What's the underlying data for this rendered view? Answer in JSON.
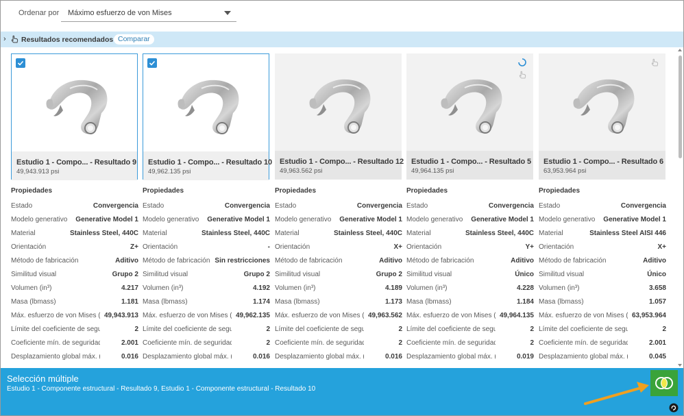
{
  "sort": {
    "label": "Ordenar por",
    "value": "Máximo esfuerzo de von Mises"
  },
  "recommended": {
    "title": "Resultados recomendados",
    "compare_label": "Comparar"
  },
  "cards": [
    {
      "title": "Estudio 1 - Compo... - Resultado 9",
      "value": "49,943.913 psi",
      "selected": true,
      "icon": "none"
    },
    {
      "title": "Estudio 1 - Compo... - Resultado 10",
      "value": "49,962.135 psi",
      "selected": true,
      "icon": "none"
    },
    {
      "title": "Estudio 1 - Compo... - Resultado 12",
      "value": "49,963.562 psi",
      "selected": false,
      "icon": "none"
    },
    {
      "title": "Estudio 1 - Compo... - Resultado 5",
      "value": "49,964.135 psi",
      "selected": false,
      "icon": "spinner-and-hand-icon"
    },
    {
      "title": "Estudio 1 - Compo... - Resultado 6",
      "value": "63,953.964 psi",
      "selected": false,
      "icon": "hand-icon"
    }
  ],
  "properties": {
    "heading": "Propiedades",
    "labels": [
      "Estado",
      "Modelo generativo",
      "Material",
      "Orientación",
      "Método de fabricación",
      "Similitud visual",
      "Volumen (in³)",
      "Masa (lbmass)",
      "Máx. esfuerzo de von Mises (...",
      "Límite del coeficiente de seguridad",
      "Coeficiente mín. de seguridad",
      "Desplazamiento global máx. (in)"
    ],
    "columns": [
      [
        "Convergencia",
        "Generative Model 1",
        "Stainless Steel, 440C",
        "Z+",
        "Aditivo",
        "Grupo 2",
        "4.217",
        "1.181",
        "49,943.913",
        "2",
        "2.001",
        "0.016"
      ],
      [
        "Convergencia",
        "Generative Model 1",
        "Stainless Steel, 440C",
        "-",
        "Sin restricciones",
        "Grupo 2",
        "4.192",
        "1.174",
        "49,962.135",
        "2",
        "2",
        "0.016"
      ],
      [
        "Convergencia",
        "Generative Model 1",
        "Stainless Steel, 440C",
        "X+",
        "Aditivo",
        "Grupo 2",
        "4.189",
        "1.173",
        "49,963.562",
        "2",
        "2",
        "0.016"
      ],
      [
        "Convergencia",
        "Generative Model 1",
        "Stainless Steel, 440C",
        "Y+",
        "Aditivo",
        "Único",
        "4.228",
        "1.184",
        "49,964.135",
        "2",
        "2",
        "0.019"
      ],
      [
        "Convergencia",
        "Generative Model 1",
        "Stainless Steel AISI 446",
        "X+",
        "Aditivo",
        "Único",
        "3.658",
        "1.057",
        "63,953.964",
        "2",
        "2.001",
        "0.045"
      ]
    ]
  },
  "multi_selection": {
    "title": "Selección múltiple",
    "description": "Estudio 1 - Componente estructural - Resultado 9, Estudio 1 - Componente estructural - Resultado 10"
  },
  "colors": {
    "selection_blue": "#25a2dc",
    "compare_green": "#3aa33a",
    "arrow_orange": "#f0a020"
  }
}
